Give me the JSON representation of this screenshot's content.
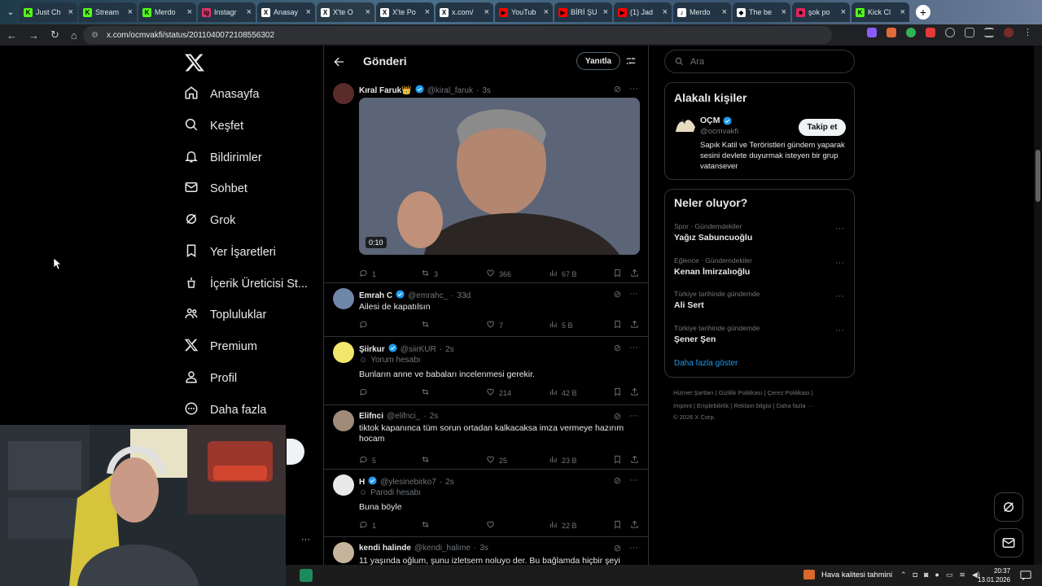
{
  "browser": {
    "tabs": [
      {
        "title": "Just Ch",
        "favicon": "K",
        "color": "#53fc18"
      },
      {
        "title": "Stream",
        "favicon": "K",
        "color": "#53fc18"
      },
      {
        "title": "Merdo",
        "favicon": "K",
        "color": "#53fc18"
      },
      {
        "title": "Instagr",
        "favicon": "ig",
        "color": "#e1306c"
      },
      {
        "title": "Anasay",
        "favicon": "X",
        "color": "#ffffff"
      },
      {
        "title": "X'te O",
        "favicon": "X",
        "color": "#ffffff"
      },
      {
        "title": "X'te Po",
        "favicon": "X",
        "color": "#ffffff"
      },
      {
        "title": "x.com/",
        "favicon": "X",
        "color": "#ffffff"
      },
      {
        "title": "YouTub",
        "favicon": "▶",
        "color": "#ff0000"
      },
      {
        "title": "BİRİ ŞU",
        "favicon": "▶",
        "color": "#ff0000"
      },
      {
        "title": "(1) Jad",
        "favicon": "▶",
        "color": "#ff0000"
      },
      {
        "title": "Merdo",
        "favicon": "♪",
        "color": "#ffffff"
      },
      {
        "title": "The be",
        "favicon": "◆",
        "color": "#ffffff"
      },
      {
        "title": "şok po",
        "favicon": "■",
        "color": "#e0245e"
      },
      {
        "title": "Kick Cl",
        "favicon": "K",
        "color": "#53fc18"
      }
    ],
    "url": "x.com/ocmvakfi/status/2011040072108556302"
  },
  "nav": {
    "items": [
      {
        "label": "Anasayfa",
        "icon": "home-icon"
      },
      {
        "label": "Keşfet",
        "icon": "search-icon"
      },
      {
        "label": "Bildirimler",
        "icon": "bell-icon"
      },
      {
        "label": "Sohbet",
        "icon": "mail-icon"
      },
      {
        "label": "Grok",
        "icon": "grok-icon"
      },
      {
        "label": "Yer İşaretleri",
        "icon": "bookmark-icon"
      },
      {
        "label": "İçerik Üreticisi St...",
        "icon": "creator-icon"
      },
      {
        "label": "Topluluklar",
        "icon": "communities-icon"
      },
      {
        "label": "Premium",
        "icon": "x-icon"
      },
      {
        "label": "Profil",
        "icon": "profile-icon"
      },
      {
        "label": "Daha fazla",
        "icon": "more-circle-icon"
      }
    ],
    "more_dots": "···"
  },
  "main": {
    "title": "Gönderi",
    "reply_button": "Yanıtla",
    "tweets": [
      {
        "name": "Kıral Faruk👑",
        "handle": "@kiral_faruk",
        "time": "3s",
        "verified": true,
        "text": "",
        "sub": "",
        "video_duration": "0:10",
        "replies": "1",
        "reposts": "3",
        "likes": "366",
        "views": "67 B"
      },
      {
        "name": "Emrah C",
        "handle": "@emrahc_",
        "time": "33d",
        "verified": true,
        "text": "Ailesi de kapatılsın",
        "sub": "",
        "replies": "",
        "reposts": "",
        "likes": "7",
        "views": "5 B"
      },
      {
        "name": "Şiirkur",
        "handle": "@siirKUR",
        "time": "2s",
        "verified": true,
        "text": "Bunların anne ve babaları incelenmesi gerekir.",
        "sub": "Yorum hesabı",
        "replies": "",
        "reposts": "",
        "likes": "214",
        "views": "42 B"
      },
      {
        "name": "Elifnci",
        "handle": "@elifnci_",
        "time": "2s",
        "verified": false,
        "text": "tiktok kapanınca tüm sorun ortadan kalkacaksa imza vermeye hazırım hocam",
        "sub": "",
        "replies": "5",
        "reposts": "",
        "likes": "25",
        "views": "23 B"
      },
      {
        "name": "H",
        "handle": "@ylesinebirko7",
        "time": "2s",
        "verified": true,
        "text": "Buna böyle",
        "sub": "Parodi hesabı",
        "replies": "1",
        "reposts": "",
        "likes": "",
        "views": "22 B"
      },
      {
        "name": "kendi halinde",
        "handle": "@kendi_halime",
        "time": "3s",
        "verified": false,
        "text": "11 yaşında oğlum, şunu izletsem noluyo der. Bu bağlamda hiçbir şeyi",
        "sub": ""
      }
    ]
  },
  "sidebar": {
    "search_placeholder": "Ara",
    "people": {
      "title": "Alakalı kişiler",
      "name": "OÇM",
      "handle": "@ocmvakfi",
      "follow": "Takip et",
      "bio": "Sapık Katil ve Teröristleri gündem yaparak sesini devlete duyurmak isteyen bir grup vatansever"
    },
    "trends": {
      "title": "Neler oluyor?",
      "items": [
        {
          "meta": "Spor · Gündemdekiler",
          "name": "Yağız Sabuncuoğlu"
        },
        {
          "meta": "Eğlence · Gündemdekiler",
          "name": "Kenan İmirzalıoğlu"
        },
        {
          "meta": "Türkiye tarihinde gündemde",
          "name": "Ali Sert"
        },
        {
          "meta": "Türkiye tarihinde gündemde",
          "name": "Şener Şen"
        }
      ],
      "show_more": "Daha fazla göster"
    },
    "footer": {
      "line1": "Hizmet Şartları  |  Gizlilik Politikası  |  Çerez Politikası  |",
      "line2": "Imprint  |  Erişilebilirlik  |  Reklam bilgisi  |  Daha fazla ···",
      "line3": "© 2026 X Corp."
    }
  },
  "taskbar": {
    "weather": "Hava kalitesi tahmini",
    "time": "20:37",
    "date": "13.01.2026"
  },
  "colors": {
    "accent": "#1d9bf0",
    "background": "#000000",
    "muted": "#71767b"
  }
}
